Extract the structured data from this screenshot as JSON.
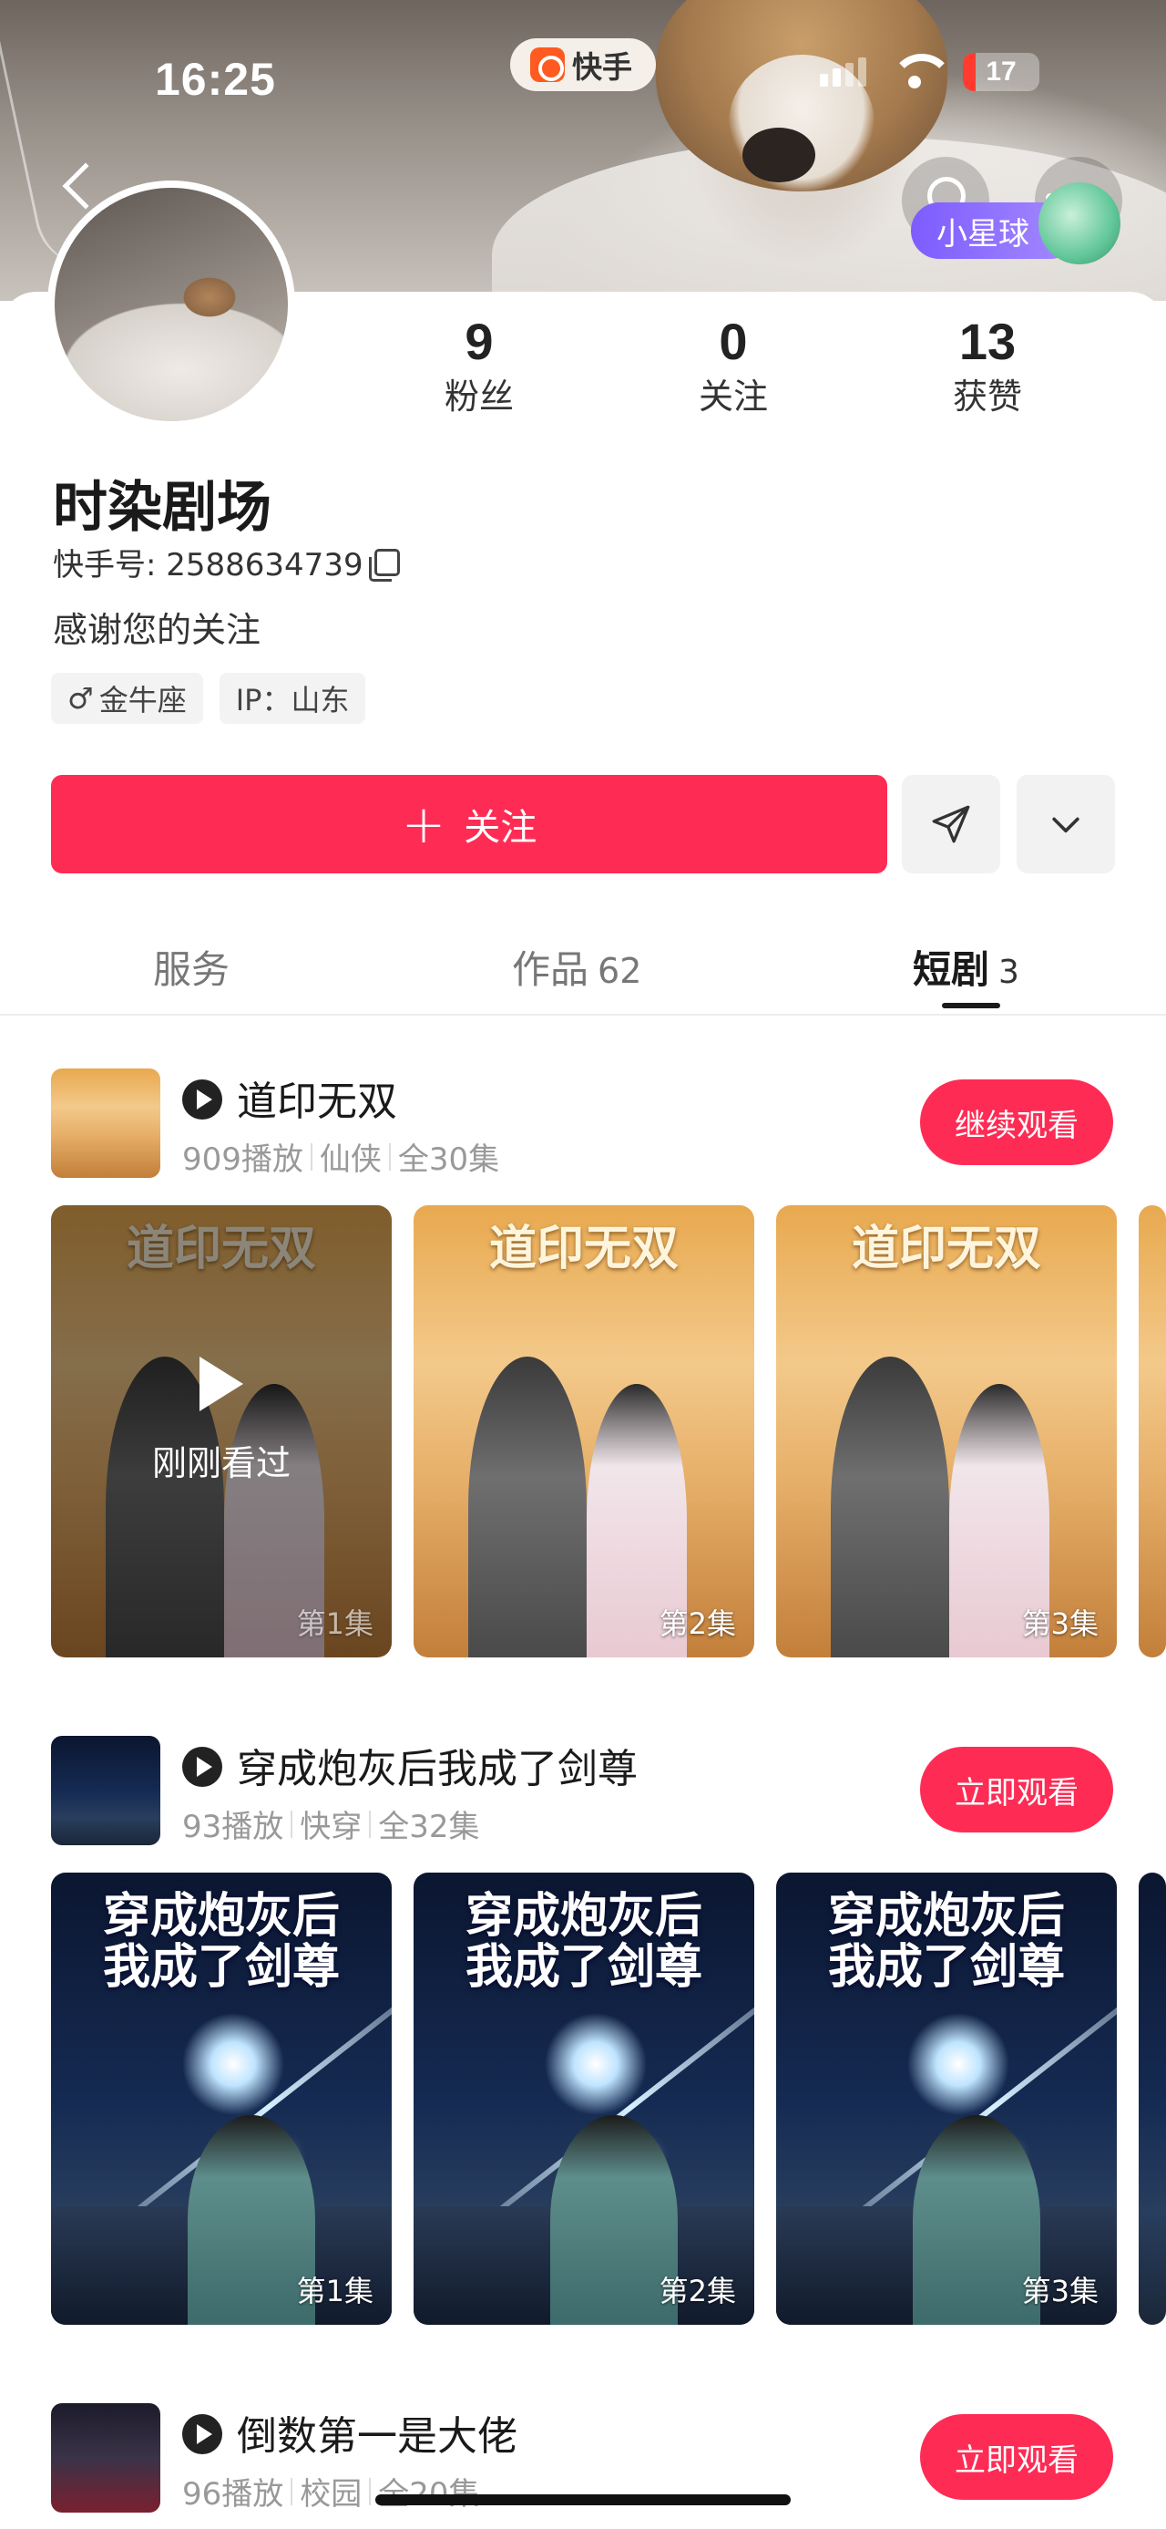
{
  "status_bar": {
    "time": "16:25",
    "app_name": "快手",
    "battery": "17"
  },
  "header": {
    "planet_badge": "小星球"
  },
  "profile": {
    "stats": [
      {
        "value": "9",
        "label": "粉丝"
      },
      {
        "value": "0",
        "label": "关注"
      },
      {
        "value": "13",
        "label": "获赞"
      }
    ],
    "name": "时染剧场",
    "uid": "快手号: 2588634739",
    "bio": "感谢您的关注",
    "tags": {
      "gender_zodiac": "金牛座",
      "ip": "IP：山东"
    }
  },
  "actions": {
    "follow_label": "关注"
  },
  "tabs": [
    {
      "label": "服务",
      "count": ""
    },
    {
      "label": "作品",
      "count": "62"
    },
    {
      "label": "短剧",
      "count": "3"
    }
  ],
  "dramas": [
    {
      "title": "道印无双",
      "plays": "909播放",
      "genre": "仙侠",
      "episodes_total": "全30集",
      "cta": "继续观看",
      "poster_title": "道印无双",
      "episodes": [
        {
          "label": "第1集",
          "watched_text": "刚刚看过"
        },
        {
          "label": "第2集"
        },
        {
          "label": "第3集"
        }
      ]
    },
    {
      "title": "穿成炮灰后我成了剑尊",
      "plays": "93播放",
      "genre": "快穿",
      "episodes_total": "全32集",
      "cta": "立即观看",
      "poster_title_l1": "穿成炮灰后",
      "poster_title_l2": "我成了剑尊",
      "episodes": [
        {
          "label": "第1集"
        },
        {
          "label": "第2集"
        },
        {
          "label": "第3集"
        }
      ]
    },
    {
      "title": "倒数第一是大佬",
      "plays": "96播放",
      "genre": "校园",
      "episodes_total": "全20集",
      "cta": "立即观看"
    }
  ],
  "colors": {
    "accent": "#fe2c55",
    "planet": "#7d5cff"
  }
}
